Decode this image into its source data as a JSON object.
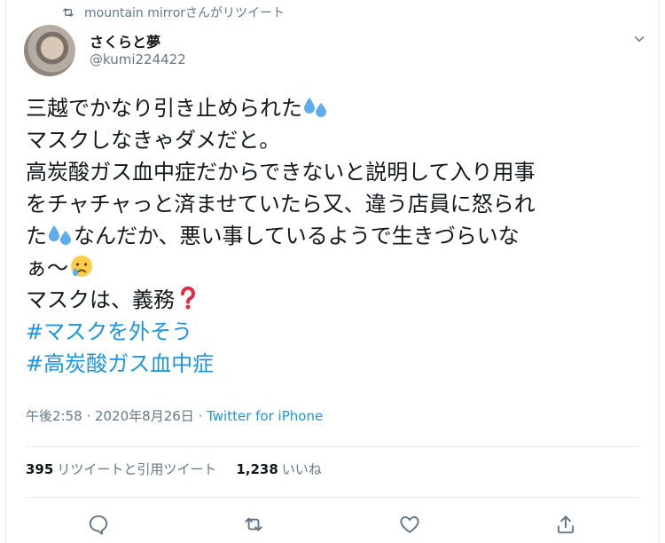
{
  "retweet_banner": "mountain mirrorさんがリツイート",
  "author": {
    "name": "さくらと夢",
    "handle": "@kumi224422"
  },
  "tweet": {
    "lines": [
      "三越でかなり引き止められた",
      "マスクしなきゃダメだと。",
      "高炭酸ガス血中症だからできないと説明して入り用事",
      "をチャチャっと済ませていたら又、違う店員に怒られ",
      "た",
      "なんだか、悪い事しているようで生きづらいな",
      "ぁ〜",
      "マスクは、義務"
    ],
    "hashtags": [
      "#マスクを外そう",
      "#高炭酸ガス血中症"
    ]
  },
  "meta": {
    "time": "午後2:58 · 2020年8月26日 · ",
    "source": "Twitter for iPhone"
  },
  "stats": {
    "retweets": "395",
    "retweets_label": "リツイートと引用ツイート",
    "likes": "1,238",
    "likes_label": "いいね"
  },
  "colors": {
    "link": "#1b95e0",
    "secondary": "#657786",
    "divider": "#e6ecf0"
  },
  "icons": [
    "retweet-icon",
    "caret-down-icon",
    "reply-icon",
    "retweet-action-icon",
    "like-icon",
    "share-icon",
    "sweat-droplets-emoji",
    "crying-face-emoji",
    "red-question-emoji"
  ]
}
